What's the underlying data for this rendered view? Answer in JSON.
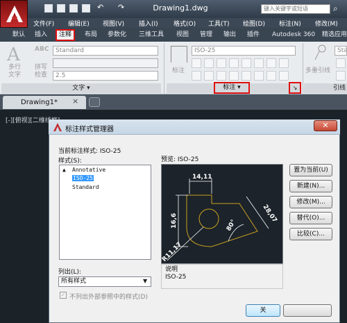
{
  "app": {
    "doc_title": "Drawing1.dwg",
    "search_placeholder": "键入关键字或短语"
  },
  "menu": [
    "文件(F)",
    "编辑(E)",
    "视图(V)",
    "插入(I)",
    "格式(O)",
    "工具(T)",
    "绘图(D)",
    "标注(N)",
    "修改(M)"
  ],
  "ribbon_tabs": [
    "默认",
    "插入",
    "注释",
    "布局",
    "参数化",
    "三维工具",
    "视图",
    "管理",
    "输出",
    "插件",
    "Autodesk 360",
    "精选应用"
  ],
  "ribbon": {
    "text_panel": {
      "multiline_text": "多行\n文字",
      "spellcheck": "拼写\n检查",
      "style_combo": "Standard",
      "height_combo": "2.5",
      "title": "文字"
    },
    "dim_panel": {
      "style_combo": "ISO-25",
      "dim_label": "标注",
      "title": "标注"
    },
    "leader_panel": {
      "multileader": "多重引线",
      "style_combo": "Stan",
      "title": "引线"
    }
  },
  "drawing_tab": {
    "label": "Drawing1*"
  },
  "viewport_label": "[-][俯视][二维线框]",
  "dialog": {
    "title": "标注样式管理器",
    "current_style_label": "当前标注样式: ISO-25",
    "styles_label": "样式(S):",
    "styles": [
      "Annotative",
      "ISO-25",
      "Standard"
    ],
    "preview_label": "预览: ISO-25",
    "list_label": "列出(L):",
    "list_value": "所有样式",
    "exclude_xref_label": "不列出外部参照中的样式(D)",
    "description_label": "说明",
    "description_value": "ISO-25",
    "buttons": [
      "置为当前(U)",
      "新建(N)...",
      "修改(M)...",
      "替代(O)...",
      "比较(C)..."
    ],
    "close_label": "关",
    "preview_dims": {
      "top": "14,11",
      "left": "16,6",
      "right": "28,07",
      "angle": "80°",
      "radius": "R11,17"
    }
  },
  "colors": {
    "accent_red": "#e01010",
    "preview_line": "#c8a020",
    "selection_blue": "#3399ff"
  }
}
